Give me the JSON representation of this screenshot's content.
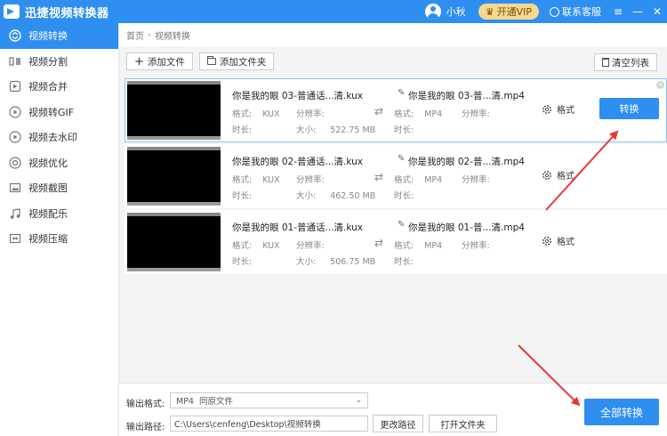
{
  "app": {
    "title": "迅捷视频转换器",
    "username": "小秋",
    "vip_label": "开通VIP",
    "service_label": "联系客服"
  },
  "sidebar": {
    "items": [
      {
        "label": "视频转换",
        "icon": "convert-icon",
        "active": true
      },
      {
        "label": "视频分割",
        "icon": "split-icon"
      },
      {
        "label": "视频合并",
        "icon": "merge-icon"
      },
      {
        "label": "视频转GIF",
        "icon": "gif-icon"
      },
      {
        "label": "视频去水印",
        "icon": "watermark-icon"
      },
      {
        "label": "视频优化",
        "icon": "optimize-icon"
      },
      {
        "label": "视频截图",
        "icon": "screenshot-icon"
      },
      {
        "label": "视频配乐",
        "icon": "music-icon"
      },
      {
        "label": "视频压缩",
        "icon": "compress-icon"
      }
    ]
  },
  "breadcrumb": {
    "home": "首页",
    "sep": "›",
    "current": "视频转换"
  },
  "toolbar": {
    "add_file": "添加文件",
    "add_folder": "添加文件夹",
    "clear_list": "清空列表"
  },
  "meta_labels": {
    "format": "格式:",
    "resolution": "分辨率:",
    "duration": "时长:",
    "size": "大小:"
  },
  "files": [
    {
      "src_name": "你是我的眼 03-普通话...清.kux",
      "src_format": "KUX",
      "size": "522.75 MB",
      "dst_name": "你是我的眼 03-普...清.mp4",
      "dst_format": "MP4",
      "format_label": "格式",
      "convert_label": "转换",
      "selected": true
    },
    {
      "src_name": "你是我的眼 02-普通话...清.kux",
      "src_format": "KUX",
      "size": "462.50 MB",
      "dst_name": "你是我的眼 02-普...清.mp4",
      "dst_format": "MP4",
      "format_label": "格式"
    },
    {
      "src_name": "你是我的眼 01-普通话...清.kux",
      "src_format": "KUX",
      "size": "506.75 MB",
      "dst_name": "你是我的眼 01-普...清.mp4",
      "dst_format": "MP4",
      "format_label": "格式"
    }
  ],
  "bottom": {
    "output_format_label": "输出格式:",
    "output_format_value": "MP4  同原文件",
    "output_path_label": "输出路径:",
    "output_path_value": "C:\\Users\\cenfeng\\Desktop\\视频转换",
    "change_path": "更改路径",
    "open_folder": "打开文件夹",
    "convert_all": "全部转换"
  },
  "colors": {
    "accent": "#2e8ff0",
    "vip": "#f6d98f",
    "arrow": "#e53935"
  }
}
